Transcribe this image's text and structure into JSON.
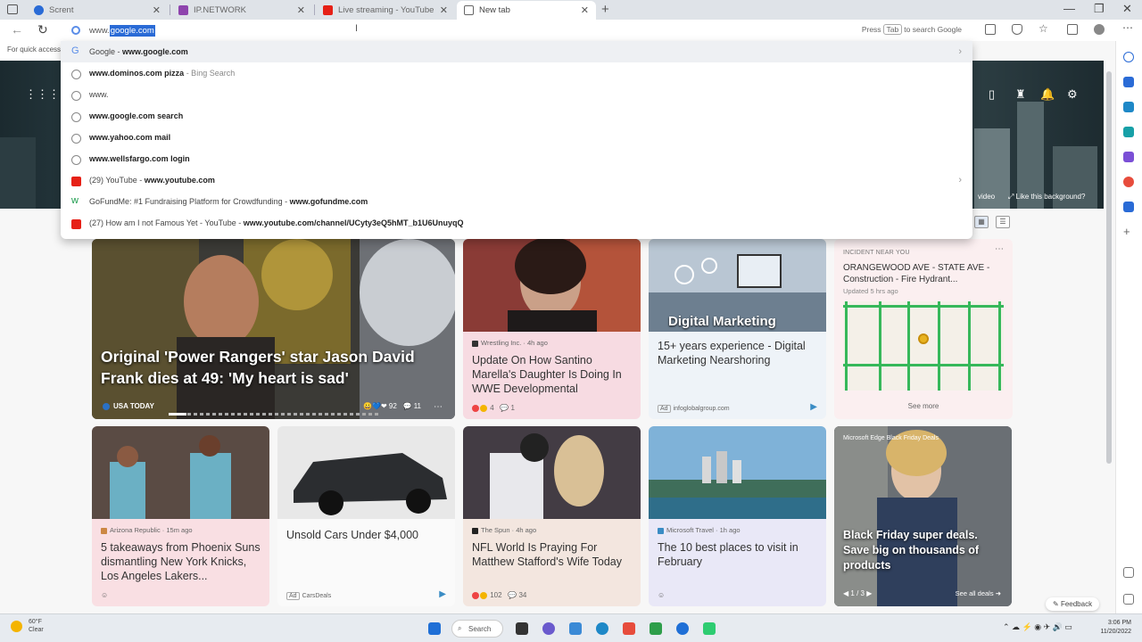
{
  "tabs": [
    {
      "label": "Scrent",
      "icon_color": "#2a6bd6"
    },
    {
      "label": "IP.NETWORK",
      "icon_color": "#8e44ad"
    },
    {
      "label": "Live streaming - YouTube Studio",
      "icon_color": "#e62117"
    },
    {
      "label": "New tab",
      "icon_color": "#666666"
    }
  ],
  "address": {
    "prefix": "www.",
    "selected": "google.com",
    "hint_press": "Press",
    "hint_key": "Tab",
    "hint_after": "to search Google"
  },
  "favorites_hint": "For quick access",
  "suggestions": [
    {
      "icon": "google-icon",
      "text": "Google - ",
      "bold": "www.google.com",
      "sub": "",
      "arrow": true
    },
    {
      "icon": "search-icon",
      "text": "",
      "bold": "www.dominos.com pizza",
      "sub": " - Bing Search",
      "arrow": false
    },
    {
      "icon": "search-icon",
      "text": "www.",
      "bold": "",
      "sub": "",
      "arrow": false
    },
    {
      "icon": "search-icon",
      "text": "",
      "bold": "www.google.com search",
      "sub": "",
      "arrow": false
    },
    {
      "icon": "search-icon",
      "text": "",
      "bold": "www.yahoo.com mail",
      "sub": "",
      "arrow": false
    },
    {
      "icon": "search-icon",
      "text": "",
      "bold": "www.wellsfargo.com login",
      "sub": "",
      "arrow": false
    },
    {
      "icon": "youtube-icon",
      "text": "(29) YouTube - ",
      "bold": "www.youtube.com",
      "sub": "",
      "arrow": true
    },
    {
      "icon": "gofundme-icon",
      "text": "GoFundMe: #1 Fundraising Platform for Crowdfunding - ",
      "bold": "www.gofundme.com",
      "sub": "",
      "arrow": false
    },
    {
      "icon": "youtube-icon",
      "text": "(27) How am I not Famous Yet - YouTube - ",
      "bold": "www.youtube.com/channel/UCyty3eQ5hMT_b1U6UnuyqQ",
      "sub": "",
      "arrow": false
    }
  ],
  "hero_right": {
    "video": "video",
    "background": "Like this background?"
  },
  "cards": {
    "hero": {
      "title": "Original 'Power Rangers' star Jason David Frank dies at 49: 'My heart is sad'",
      "source": "USA TODAY",
      "reactions": "92",
      "comments": "11"
    },
    "wrestling": {
      "source": "Wrestling Inc. · 4h ago",
      "title": "Update On How Santino Marella's Daughter Is Doing In WWE Developmental",
      "reactions": "4",
      "comments": "1"
    },
    "digital": {
      "image_text": "Digital Marketing",
      "title": "15+ years experience - Digital Marketing Nearshoring",
      "ad_label": "Ad",
      "ad_source": "infoglobalgroup.com"
    },
    "incident": {
      "label": "INCIDENT NEAR YOU",
      "title": "ORANGEWOOD AVE - STATE AVE - Construction - Fire Hydrant...",
      "time": "Updated 5 hrs ago",
      "see_more": "See more"
    },
    "suns": {
      "source": "Arizona Republic · 15m ago",
      "title": "5 takeaways from Phoenix Suns dismantling New York Knicks, Los Angeles Lakers..."
    },
    "cars": {
      "title": "Unsold Cars Under $4,000",
      "ad_label": "Ad",
      "ad_source": "CarsDeals"
    },
    "nfl": {
      "source": "The Spun · 4h ago",
      "title": "NFL World Is Praying For Matthew Stafford's Wife Today",
      "reactions": "102",
      "comments": "34"
    },
    "travel": {
      "source": "Microsoft Travel · 1h ago",
      "title": "The 10 best places to visit in February"
    },
    "blackfriday": {
      "source": "Microsoft Edge Black Friday Deals",
      "title": "Black Friday super deals. Save big on thousands of products",
      "pager": "1 / 3",
      "see_all": "See all deals"
    }
  },
  "feedback": "Feedback",
  "taskbar": {
    "weather_temp": "60°F",
    "weather_desc": "Clear",
    "search": "Search",
    "time": "3:06 PM",
    "date": "11/20/2022"
  },
  "colors": {
    "accent": "#2a6bd6",
    "youtube": "#e62117"
  }
}
